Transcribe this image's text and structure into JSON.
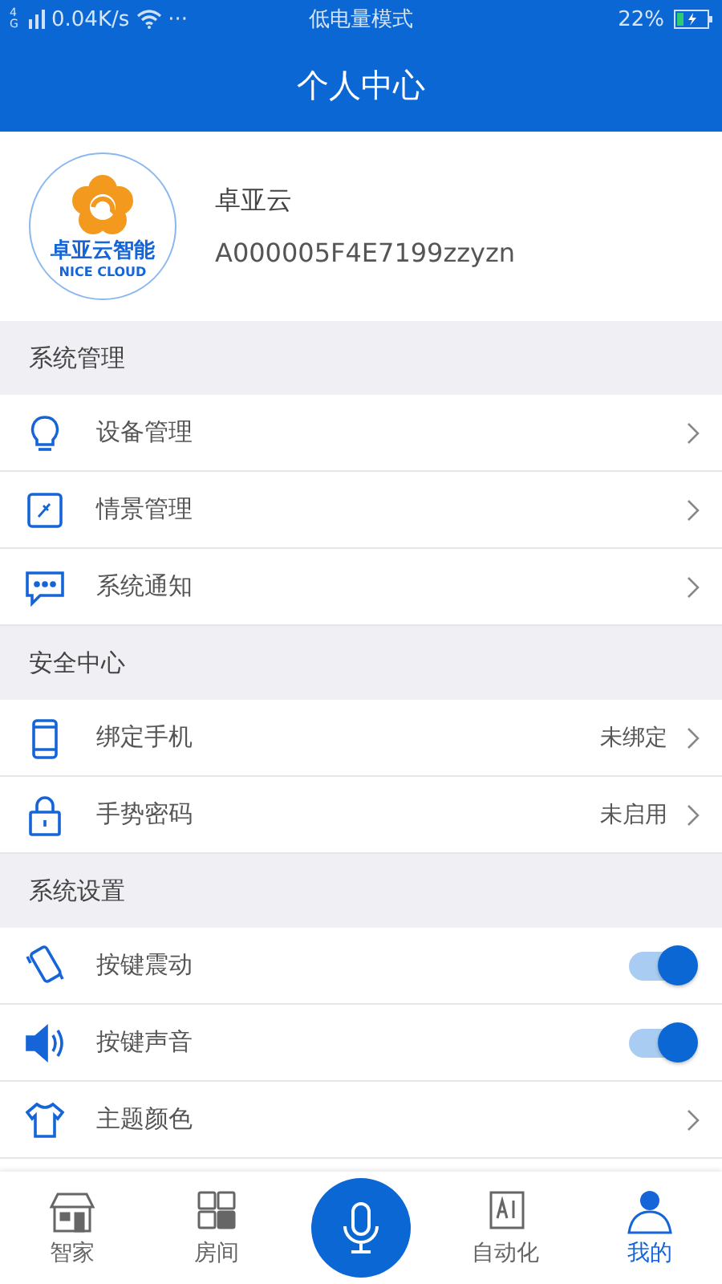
{
  "status_bar": {
    "network": "4G",
    "speed": "0.04K/s",
    "more": "···",
    "mode": "低电量模式",
    "battery": "22%"
  },
  "header": {
    "title": "个人中心"
  },
  "profile": {
    "name": "卓亚云",
    "account": "A000005F4E7199zzyzn",
    "logo_text": "卓亚云智能",
    "logo_subtext": "NICE CLOUD"
  },
  "sections": [
    {
      "title": "系统管理",
      "items": [
        {
          "kind": "link",
          "label": "设备管理"
        },
        {
          "kind": "link",
          "label": "情景管理"
        },
        {
          "kind": "link",
          "label": "系统通知"
        }
      ]
    },
    {
      "title": "安全中心",
      "items": [
        {
          "kind": "link",
          "label": "绑定手机",
          "value": "未绑定"
        },
        {
          "kind": "link",
          "label": "手势密码",
          "value": "未启用"
        }
      ]
    },
    {
      "title": "系统设置",
      "items": [
        {
          "kind": "toggle",
          "label": "按键震动",
          "on": true
        },
        {
          "kind": "toggle",
          "label": "按键声音",
          "on": true
        },
        {
          "kind": "link",
          "label": "主题颜色"
        }
      ]
    }
  ],
  "tabs": [
    {
      "kind": "tab",
      "label": "智家",
      "selected": false
    },
    {
      "kind": "tab",
      "label": "房间",
      "selected": false
    },
    {
      "kind": "voice"
    },
    {
      "kind": "tab",
      "label": "自动化",
      "selected": false
    },
    {
      "kind": "tab",
      "label": "我的",
      "selected": true
    }
  ]
}
